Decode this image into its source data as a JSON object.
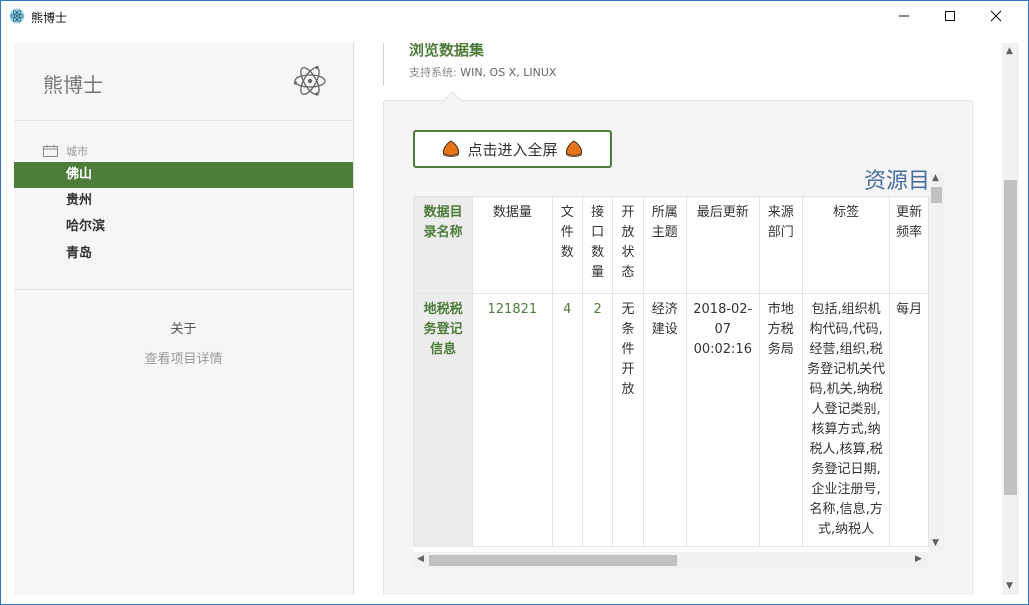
{
  "window": {
    "title": "熊博士"
  },
  "sidebar": {
    "brand": "熊博士",
    "section_label": "城市",
    "cities": [
      "佛山",
      "贵州",
      "哈尔滨",
      "青岛"
    ],
    "active_city": "佛山",
    "about": "关于",
    "detail_link": "查看项目详情"
  },
  "content": {
    "heading": "浏览数据集",
    "support_label": "支持系统: ",
    "support_systems": "WIN, OS X, LINUX",
    "fullscreen_button": "点击进入全屏",
    "resource_title": "资源目录",
    "table": {
      "headers": [
        "数据目录名称",
        "数据量",
        "文件数",
        "接口数量",
        "开放状态",
        "所属主题",
        "最后更新",
        "来源部门",
        "标签",
        "更新频率"
      ],
      "rows": [
        [
          "地税税务登记信息",
          "121821",
          "4",
          "2",
          "无条件开放",
          "经济建设",
          "2018-02-07 00:02:16",
          "市地方税务局",
          "包括,组织机构代码,代码,经营,组织,税务登记机关代码,机关,纳税人登记类别,核算方式,纳税人,核算,税务登记日期,企业注册号,名称,信息,方式,纳税人",
          "每月"
        ]
      ]
    }
  },
  "colors": {
    "accent": "#4e7c3b",
    "resource_title": "#4a6f9e",
    "window_border": "#2b79c9"
  },
  "icons": {
    "app": "atom-icon",
    "brand": "atom-icon",
    "section": "calendar-icon",
    "button": "chestnut-icon"
  }
}
